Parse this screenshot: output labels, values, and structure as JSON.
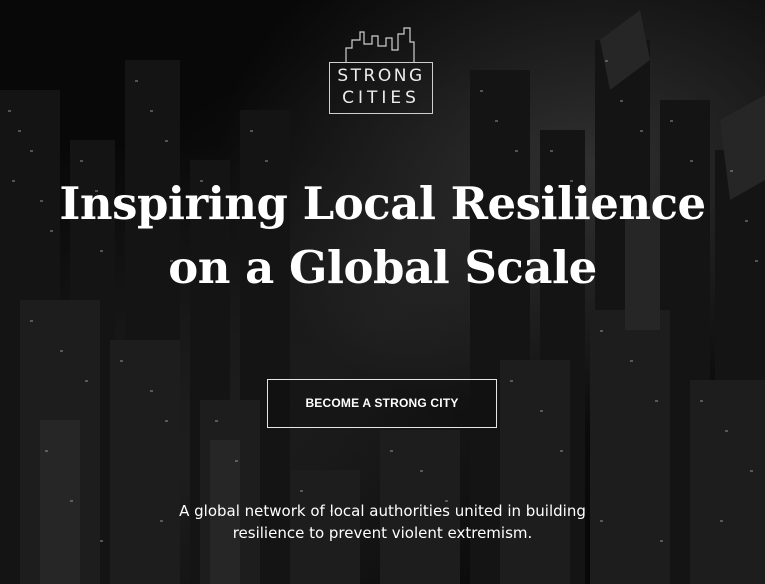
{
  "logo": {
    "line1": "STRONG",
    "line2": "CITIES",
    "icon": "city-skyline-icon"
  },
  "hero": {
    "headline_line1": "Inspiring Local Resilience",
    "headline_line2": "on a Global Scale",
    "cta_label": "BECOME A STRONG CITY",
    "tagline_line1": "A global network of local authorities united in building",
    "tagline_line2": "resilience to prevent violent extremism."
  },
  "colors": {
    "background": "#080808",
    "text": "#ffffff",
    "border": "#e6e6e6"
  }
}
